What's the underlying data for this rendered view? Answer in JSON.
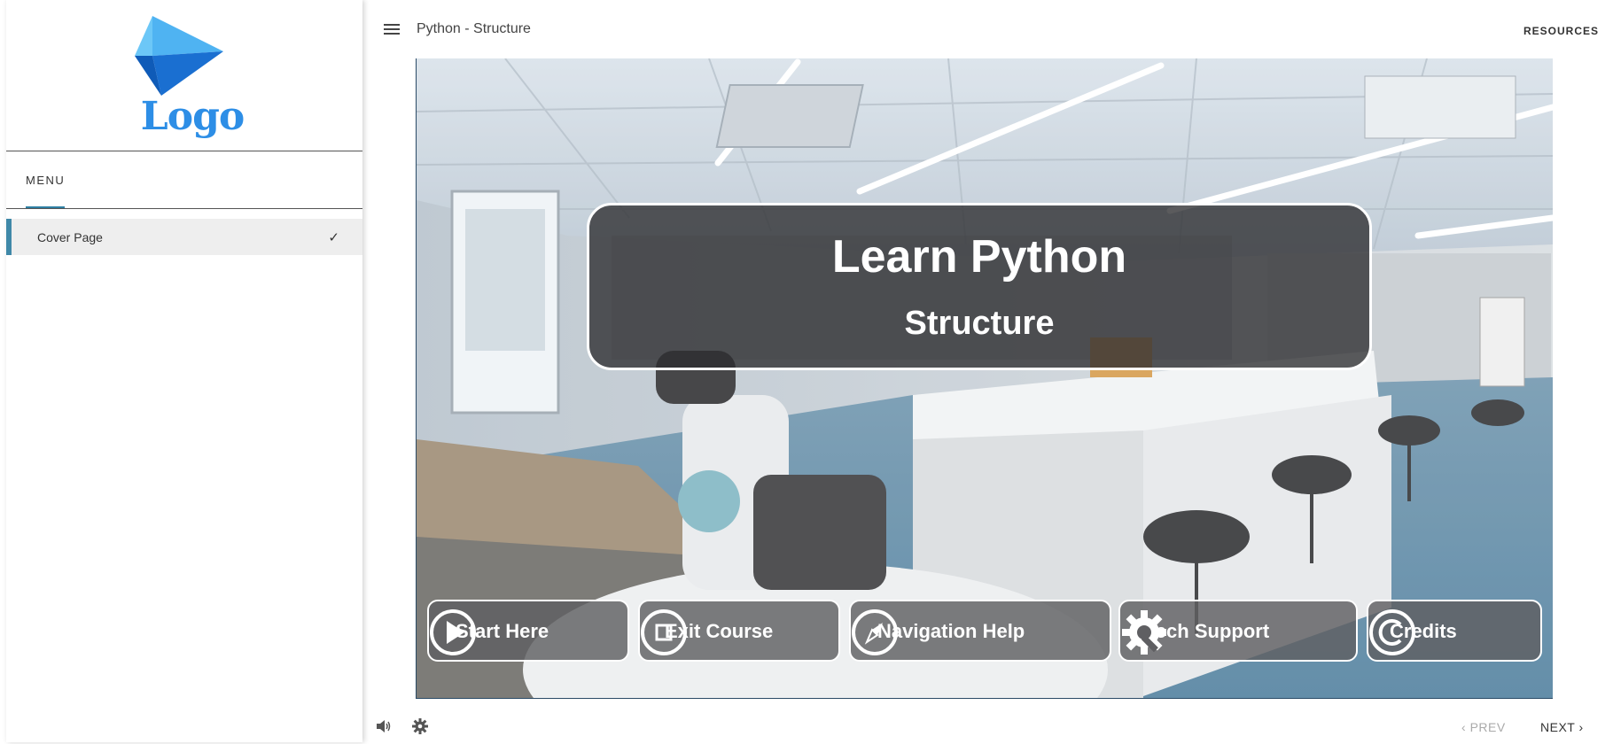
{
  "sidebar": {
    "logo_text": "Logo",
    "menu_label": "MENU",
    "items": [
      {
        "label": "Cover Page",
        "completed": true
      }
    ]
  },
  "topbar": {
    "title": "Python - Structure",
    "resources_label": "RESOURCES"
  },
  "slide": {
    "title": "Learn Python",
    "subtitle": "Structure",
    "buttons": [
      {
        "label": "Start Here",
        "icon": "play-icon"
      },
      {
        "label": "Exit Course",
        "icon": "stop-icon"
      },
      {
        "label": "Navigation Help",
        "icon": "compass-icon"
      },
      {
        "label": "Tech Support",
        "icon": "gear-wrench-icon"
      },
      {
        "label": "Credits",
        "icon": "copyright-icon"
      }
    ]
  },
  "footer": {
    "prev_label": "PREV",
    "next_label": "NEXT"
  },
  "colors": {
    "accent": "#3f88a8",
    "logo_blue": "#2d8ee6"
  }
}
